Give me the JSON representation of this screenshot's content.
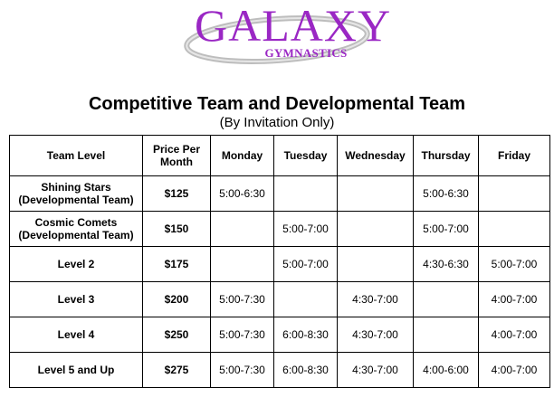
{
  "logo": {
    "main": "GALAXY",
    "sub": "GYMNASTICS",
    "color": "#9a27c4"
  },
  "title": "Competitive Team and Developmental Team",
  "subtitle": "(By Invitation Only)",
  "table": {
    "headers": [
      "Team Level",
      "Price Per Month",
      "Monday",
      "Tuesday",
      "Wednesday",
      "Thursday",
      "Friday"
    ],
    "rows": [
      {
        "level": "Shining Stars (Developmental Team)",
        "price": "$125",
        "days": [
          "5:00-6:30",
          "",
          "",
          "5:00-6:30",
          ""
        ]
      },
      {
        "level": "Cosmic Comets (Developmental Team)",
        "price": "$150",
        "days": [
          "",
          "5:00-7:00",
          "",
          "5:00-7:00",
          ""
        ]
      },
      {
        "level": "Level 2",
        "price": "$175",
        "days": [
          "",
          "5:00-7:00",
          "",
          "4:30-6:30",
          "5:00-7:00"
        ]
      },
      {
        "level": "Level 3",
        "price": "$200",
        "days": [
          "5:00-7:30",
          "",
          "4:30-7:00",
          "",
          "4:00-7:00"
        ]
      },
      {
        "level": "Level 4",
        "price": "$250",
        "days": [
          "5:00-7:30",
          "6:00-8:30",
          "4:30-7:00",
          "",
          "4:00-7:00"
        ]
      },
      {
        "level": "Level 5 and Up",
        "price": "$275",
        "days": [
          "5:00-7:30",
          "6:00-8:30",
          "4:30-7:00",
          "4:00-6:00",
          "4:00-7:00"
        ]
      }
    ]
  }
}
